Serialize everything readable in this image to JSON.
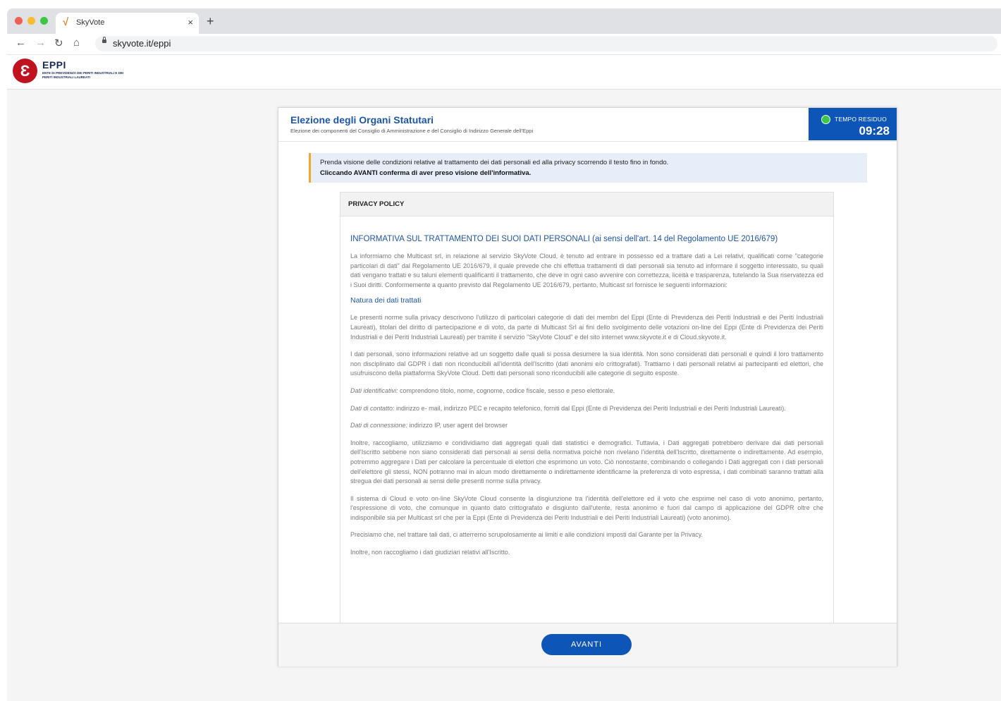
{
  "browser": {
    "tab_title": "SkyVote",
    "tab_favicon": "√",
    "tab_close": "×",
    "new_tab": "+",
    "url": "skyvote.it/eppi",
    "nav": {
      "back": "←",
      "forward": "→",
      "reload": "↻",
      "home": "⌂"
    }
  },
  "site": {
    "logo_title": "EPPI",
    "logo_symbol": "Ɛ",
    "logo_subtitle": "ENTE DI PREVIDENZA DEI PERITI INDUSTRIALI E DEI PERITI INDUSTRIALI LAUREATI"
  },
  "card": {
    "title": "Elezione degli Organi Statutari",
    "subtitle": "Elezione dei componenti del Consiglio di Amministrazione e del Consiglio di Indirizzo Generale dell'Eppi",
    "timer_label": "TEMPO RESIDUO",
    "timer_value": "09:28",
    "notice_line1": "Prenda visione delle condizioni relative al trattamento dei dati personali ed alla privacy scorrendo il testo fino in fondo.",
    "notice_line2": "Cliccando AVANTI conferma di aver preso visione dell'informativa.",
    "button_label": "AVANTI"
  },
  "policy": {
    "header": "PRIVACY POLICY",
    "title": "INFORMATIVA SUL TRATTAMENTO DEI SUOI DATI PERSONALI (ai sensi dell'art. 14 del Regolamento UE 2016/679)",
    "p1": "La informiamo che Multicast srl, in relazione al servizio SkyVote Cloud, è tenuto ad entrare in possesso ed a trattare dati a Lei relativi, qualificati come \"categorie particolari di dati\" dal Regolamento UE 2016/679, il quale prevede che chi effettua trattamenti di dati personali sia tenuto ad informare il soggetto interessato, su quali dati vengano trattati e su taluni elementi qualificanti il trattamento, che deve in ogni caso avvenire con correttezza, liceità e trasparenza, tutelando la Sua riservatezza ed i Suoi diritti. Conformemente a quanto previsto dal Regolamento UE 2016/679, pertanto, Multicast srl fornisce le seguenti informazioni:",
    "h1": "Natura dei dati trattati",
    "p2": "Le presenti norme sulla privacy descrivono l'utilizzo di particolari categorie di dati dei membri del Eppi (Ente di Previdenza dei Periti Industriali e dei Periti Industriali Laureati), titolari del diritto di partecipazione e di voto, da parte di Multicast Srl ai fini dello svolgimento delle votazioni on-line del Eppi (Ente di Previdenza dei Periti Industriali e dei Periti Industriali Laureati) per tramite il servizio \"SkyVote Cloud\" e del sito internet www.skyvote.it e di Cloud.skyvote.it.",
    "p3": "I dati personali, sono informazioni relative ad un soggetto dalle quali si possa desumere la sua identità. Non sono considerati dati personali e quindi il loro trattamento non disciplinato dal GDPR i dati non riconducibili all'identità dell'Iscritto (dati anonimi e/o crittografati). Trattiamo i dati personali relativi ai partecipanti ed elettori, che usufruiscono della piattaforma SkyVote Cloud. Detti dati personali sono riconducibili alle categorie di seguito esposte.",
    "p4_label": "Dati identificativi:",
    "p4_text": " comprendono titolo, nome, cognome, codice fiscale, sesso e peso elettorale.",
    "p5_label": "Dati di contatto:",
    "p5_text": " indirizzo e- mail, indirizzo PEC e recapito telefonico, forniti dal Eppi (Ente di Previdenza dei Periti Industriali e dei Periti Industriali Laureati).",
    "p6_label": "Dati di connessione:",
    "p6_text": " indirizzo IP, user agent del browser",
    "p7": "Inoltre, raccogliamo, utilizziamo e condividiamo dati aggregati quali dati statistici e demografici. Tuttavia, i Dati aggregati potrebbero derivare dai dati personali dell'Iscritto sebbene non siano considerati dati personali ai sensi della normativa poiché non rivelano l'identità dell'Iscritto, direttamente o indirettamente. Ad esempio, potremmo aggregare i Dati per calcolare la percentuale di elettori che esprimono un voto. Ciò nonostante, combinando o collegando i Dati aggregati con i dati personali dell'elettore gli stessi, NON potranno mai in alcun modo direttamente o indirettamente identificarne la preferenza di voto espressa, i dati combinati saranno trattati alla stregua dei dati personali ai sensi delle presenti norme sulla privacy.",
    "p8": "Il sistema di Cloud e voto on-line SkyVote Cloud consente la disgiunzione tra l'identità dell'elettore ed il voto che esprime nel caso di voto anonimo, pertanto, l'espressione di voto, che comunque in quanto dato crittografato e disgiunto dall'utente, resta anonimo e fuori dal campo di applicazione del GDPR oltre che indisponibile sia per Multicast srl che per la Eppi (Ente di Previdenza dei Periti Industriali e dei Periti Industriali Laureati) (voto anonimo).",
    "p9": "Precisiamo che, nel trattare tali dati, ci atterremo scrupolosamente ai limiti e alle condizioni imposti dal Garante per la Privacy.",
    "p10": "Inoltre, non raccogliamo i dati giudiziari relativi all'Iscritto."
  }
}
